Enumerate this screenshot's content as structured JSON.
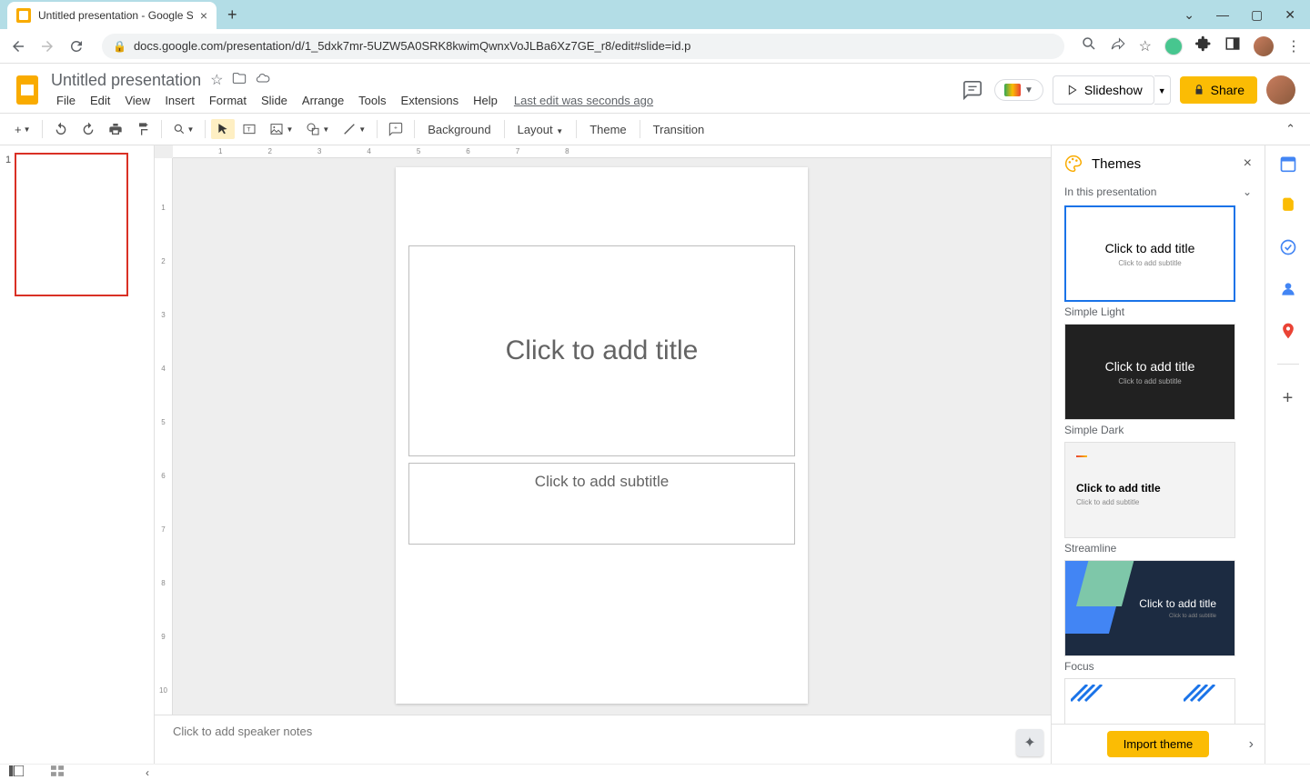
{
  "browser": {
    "tab_title": "Untitled presentation - Google Sl",
    "url": "docs.google.com/presentation/d/1_5dxk7mr-5UZW5A0SRK8kwimQwnxVoJLBa6Xz7GE_r8/edit#slide=id.p"
  },
  "doc": {
    "title": "Untitled presentation",
    "last_edit": "Last edit was seconds ago"
  },
  "menu": {
    "file": "File",
    "edit": "Edit",
    "view": "View",
    "insert": "Insert",
    "format": "Format",
    "slide": "Slide",
    "arrange": "Arrange",
    "tools": "Tools",
    "extensions": "Extensions",
    "help": "Help"
  },
  "header_buttons": {
    "slideshow": "Slideshow",
    "share": "Share"
  },
  "toolbar": {
    "background": "Background",
    "layout": "Layout",
    "theme": "Theme",
    "transition": "Transition"
  },
  "filmstrip": {
    "slide_number": "1"
  },
  "slide": {
    "title_placeholder": "Click to add title",
    "subtitle_placeholder": "Click to add subtitle"
  },
  "notes": {
    "placeholder": "Click to add speaker notes"
  },
  "themes_panel": {
    "title": "Themes",
    "section": "In this presentation",
    "import": "Import theme",
    "items": [
      {
        "name": "Simple Light",
        "title": "Click to add title",
        "sub": "Click to add subtitle"
      },
      {
        "name": "Simple Dark",
        "title": "Click to add title",
        "sub": "Click to add subtitle"
      },
      {
        "name": "Streamline",
        "title": "Click to add title",
        "sub": "Click to add subtitle"
      },
      {
        "name": "Focus",
        "title": "Click to add title",
        "sub": "Click to add subtitle"
      }
    ]
  },
  "ruler": {
    "h": [
      "1",
      "2",
      "3",
      "4",
      "5",
      "6",
      "7",
      "8"
    ],
    "v": [
      "1",
      "2",
      "3",
      "4",
      "5",
      "6",
      "7",
      "8",
      "9",
      "10"
    ]
  }
}
